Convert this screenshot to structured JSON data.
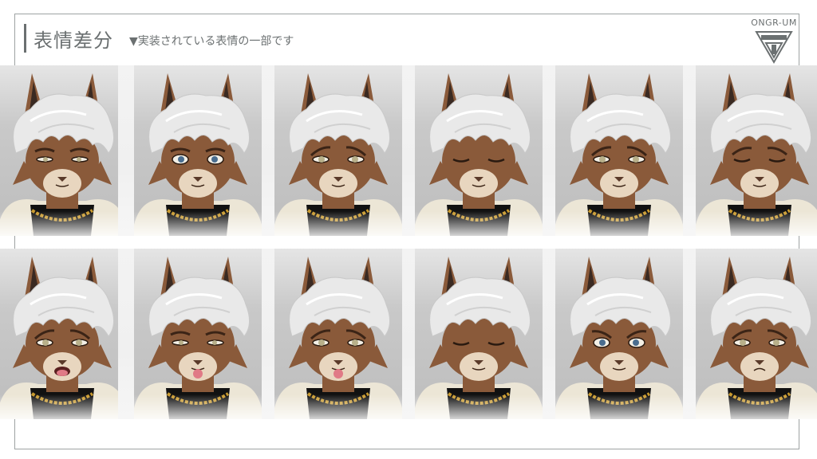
{
  "header": {
    "title": "表情差分",
    "subtitle": "▼実装されている表情の一部です"
  },
  "logo": {
    "text": "ONGR-UM"
  },
  "colors": {
    "title": "#6b7071",
    "fur": "#8a5a3a",
    "muzzle": "#e8d6bf",
    "hair": "#e9e9e9",
    "ear_inner": "#3a2a22",
    "chain": "#c99a2e",
    "shirt": "#111111",
    "jacket": "#ece6d6"
  },
  "expressions": [
    {
      "id": "r1c1",
      "eyes": "half",
      "mouth": "neutral"
    },
    {
      "id": "r1c2",
      "eyes": "open-blue",
      "mouth": "neutral"
    },
    {
      "id": "r1c3",
      "eyes": "angry",
      "mouth": "neutral"
    },
    {
      "id": "r1c4",
      "eyes": "closed",
      "mouth": "neutral"
    },
    {
      "id": "r1c5",
      "eyes": "angry",
      "mouth": "neutral"
    },
    {
      "id": "r1c6",
      "eyes": "closed-angry",
      "mouth": "neutral"
    },
    {
      "id": "r2c1",
      "eyes": "angry",
      "mouth": "open-tongue"
    },
    {
      "id": "r2c2",
      "eyes": "squint",
      "mouth": "tongue"
    },
    {
      "id": "r2c3",
      "eyes": "angry",
      "mouth": "tongue"
    },
    {
      "id": "r2c4",
      "eyes": "closed",
      "mouth": "neutral"
    },
    {
      "id": "r2c5",
      "eyes": "open-worried",
      "mouth": "neutral"
    },
    {
      "id": "r2c6",
      "eyes": "angry",
      "mouth": "pout"
    }
  ]
}
